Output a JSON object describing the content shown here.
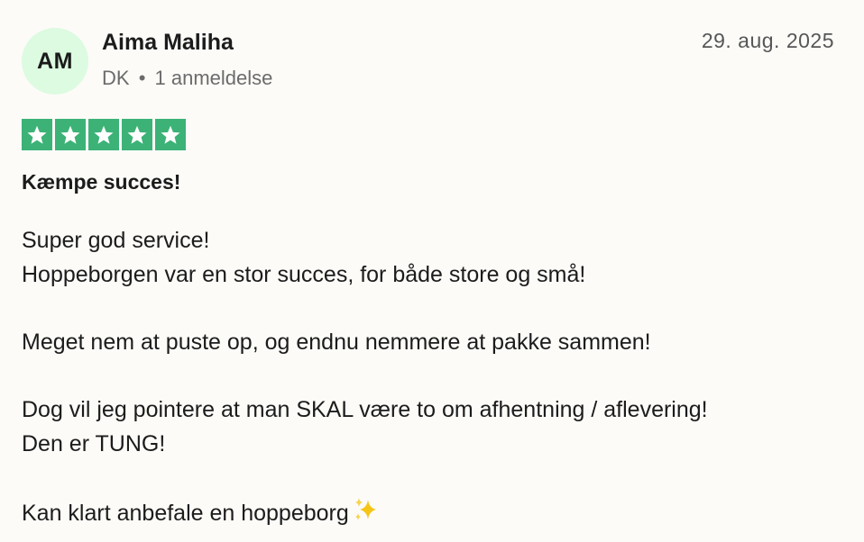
{
  "reviewer": {
    "initials": "AM",
    "name": "Aima Maliha",
    "country": "DK",
    "separator": "•",
    "review_count": "1 anmeldelse",
    "avatar_color": "#dcfbe0"
  },
  "review": {
    "date": "29. aug. 2025",
    "rating": 5,
    "max_rating": 5,
    "star_color": "#3cb277",
    "title": "Kæmpe succes!",
    "lines": [
      "Super god service!",
      "Hoppeborgen var en stor succes, for både store og små!",
      "",
      "Meget nem at puste op, og endnu nemmere at pakke sammen!",
      "",
      "Dog vil jeg pointere at man SKAL være to om afhentning / aflevering!",
      "Den er TUNG!",
      "",
      "Kan klart anbefale en hoppeborg"
    ],
    "trailing_emoji": "sparkles-icon"
  }
}
